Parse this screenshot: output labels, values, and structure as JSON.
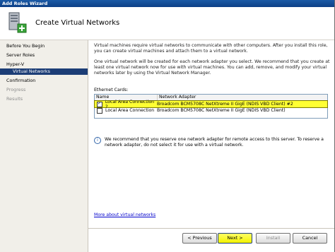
{
  "window": {
    "title": "Add Roles Wizard"
  },
  "header": {
    "title": "Create Virtual Networks",
    "icon": "server-role-icon"
  },
  "sidebar": {
    "items": [
      {
        "label": "Before You Begin",
        "state": "normal"
      },
      {
        "label": "Server Roles",
        "state": "normal"
      },
      {
        "label": "Hyper-V",
        "state": "normal"
      },
      {
        "label": "Virtual Networks",
        "state": "active"
      },
      {
        "label": "Confirmation",
        "state": "normal"
      },
      {
        "label": "Progress",
        "state": "disabled"
      },
      {
        "label": "Results",
        "state": "disabled"
      }
    ]
  },
  "content": {
    "intro1": "Virtual machines require virtual networks to communicate with other computers. After you install this role, you can create virtual machines and attach them to a virtual network.",
    "intro2": "One virtual network will be created for each network adapter you select. We recommend that you create at least one virtual network now for use with virtual machines. You can add, remove, and modify your virtual networks later by using the Virtual Network Manager.",
    "ethernet_label": "Ethernet Cards:",
    "columns": [
      "Name",
      "Network Adapter"
    ],
    "rows": [
      {
        "name": "Local Area Connection 2",
        "adapter": "Broadcom BCM5708C NetXtreme II GigE (NDIS VBD Client) #2",
        "checked": true,
        "selected": true
      },
      {
        "name": "Local Area Connection",
        "adapter": "Broadcom BCM5708C NetXtreme II GigE (NDIS VBD Client)",
        "checked": false,
        "selected": false
      }
    ],
    "info_text": "We recommend that you reserve one network adapter for remote access to this server. To reserve a network adapter, do not select it for use with a virtual network.",
    "link_text": "More about virtual networks"
  },
  "buttons": {
    "previous": "< Previous",
    "next": "Next >",
    "install": "Install",
    "cancel": "Cancel"
  },
  "colors": {
    "selection": "#ffff33",
    "active_nav": "#1c3d76",
    "titlebar": "#1b5aa6"
  }
}
